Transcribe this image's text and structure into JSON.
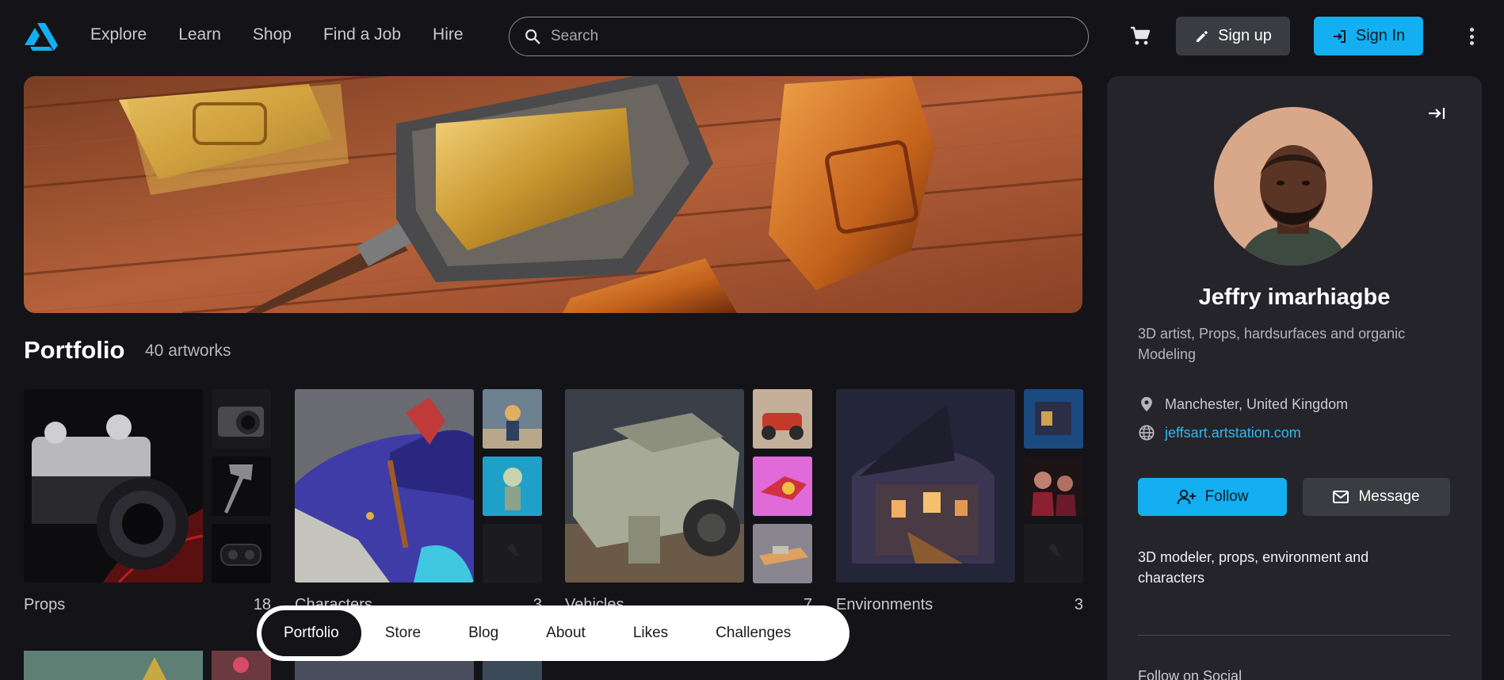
{
  "nav": {
    "items": [
      "Explore",
      "Learn",
      "Shop",
      "Find a Job",
      "Hire"
    ],
    "search_placeholder": "Search",
    "signup_label": "Sign up",
    "signin_label": "Sign In"
  },
  "portfolio": {
    "title": "Portfolio",
    "count": "40 artworks",
    "albums": [
      {
        "label": "Props",
        "count": "18"
      },
      {
        "label": "Characters",
        "count": "3"
      },
      {
        "label": "Vehicles",
        "count": "7"
      },
      {
        "label": "Environments",
        "count": "3"
      }
    ]
  },
  "tabs": [
    "Portfolio",
    "Store",
    "Blog",
    "About",
    "Likes",
    "Challenges"
  ],
  "profile": {
    "name": "Jeffry imarhiagbe",
    "headline": "3D artist, Props, hardsurfaces and organic Modeling",
    "location": "Manchester, United Kingdom",
    "website": "jeffsart.artstation.com",
    "follow_label": "Follow",
    "message_label": "Message",
    "bio": "3D modeler, props, environment and characters",
    "social_title": "Follow on Social"
  },
  "colors": {
    "accent": "#13aff0",
    "background": "#131318",
    "panel": "#24242a"
  }
}
